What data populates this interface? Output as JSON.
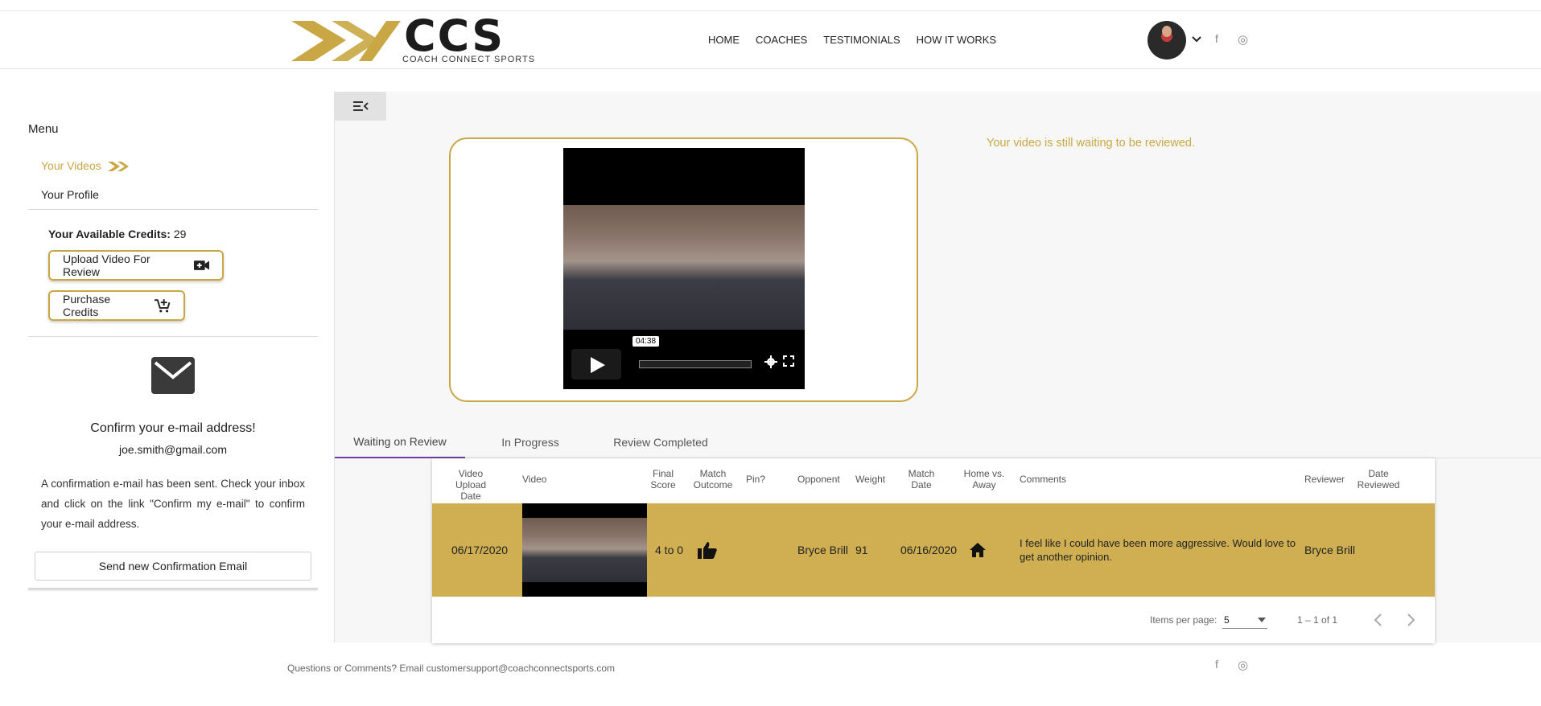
{
  "header": {
    "logo_text": "CCS",
    "logo_sub": "COACH CONNECT SPORTS",
    "nav": [
      "HOME",
      "COACHES",
      "TESTIMONIALS",
      "HOW IT WORKS"
    ],
    "social": {
      "facebook": "f",
      "instagram": "◎"
    }
  },
  "sidebar": {
    "menu_title": "Menu",
    "items": [
      {
        "label": "Your Videos",
        "icon": "ccs-logo-icon"
      },
      {
        "label": "Your Profile"
      }
    ],
    "credits_label": "Your Available Credits:",
    "credits_value": "29",
    "upload_button": "Upload Video For Review",
    "purchase_button": "Purchase Credits",
    "confirm_title": "Confirm your e-mail address!",
    "confirm_email": "joe.smith@gmail.com",
    "confirm_body": "A confirmation e-mail has been sent. Check your inbox and click on the link \"Confirm my e-mail\" to confirm your e-mail address.",
    "send_button": "Send new Confirmation Email"
  },
  "main": {
    "status_text": "Your video is still waiting to be reviewed.",
    "player": {
      "time": "04:38"
    },
    "tabs": [
      "Waiting on Review",
      "In Progress",
      "Review Completed"
    ],
    "table": {
      "headers": {
        "upload_date": "Video\nUpload Date",
        "video": "Video",
        "final_score": "Final\nScore",
        "match_outcome": "Match\nOutcome",
        "pin": "Pin?",
        "opponent": "Opponent",
        "weight": "Weight",
        "match_date": "Match\nDate",
        "home_away": "Home vs.\nAway",
        "comments": "Comments",
        "reviewer": "Reviewer",
        "date_reviewed": "Date\nReviewed"
      },
      "rows": [
        {
          "upload_date": "06/17/2020",
          "final_score": "4 to 0",
          "match_outcome_icon": "thumbs-up-icon",
          "opponent": "Bryce Brill",
          "weight": "91",
          "match_date": "06/16/2020",
          "home_away_icon": "home-icon",
          "comments": "I feel like I could have been more aggressive. Would love to get another opinion.",
          "reviewer": "Bryce Brill"
        }
      ]
    },
    "paginator": {
      "items_per_page_label": "Items per page:",
      "items_per_page": "5",
      "range": "1 – 1 of 1"
    }
  },
  "footer": {
    "text": "Questions or Comments? Email customersupport@coachconnectsports.com"
  },
  "colors": {
    "accent": "#c9a745",
    "row_highlight": "#cfaf52",
    "tab_indicator": "#6b3fa0"
  }
}
